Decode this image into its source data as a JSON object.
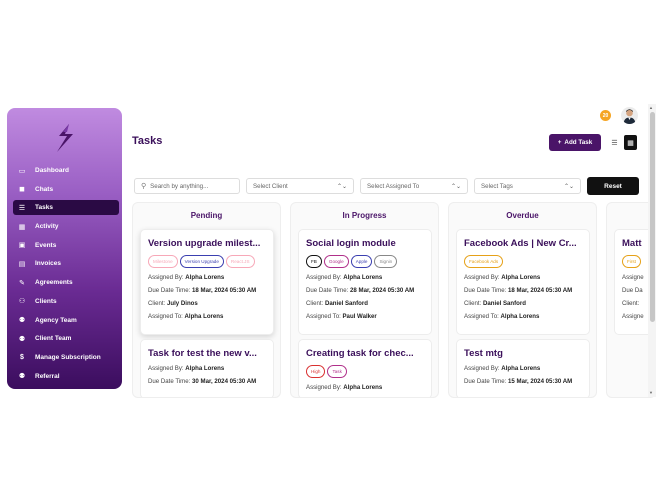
{
  "page": {
    "title": "Tasks"
  },
  "header": {
    "notification_count": "20",
    "add_task_label": "Add Task",
    "add_icon": "+"
  },
  "sidebar": {
    "items": [
      {
        "label": "Dashboard",
        "icon": "▭"
      },
      {
        "label": "Chats",
        "icon": "◼"
      },
      {
        "label": "Tasks",
        "icon": "☰"
      },
      {
        "label": "Activity",
        "icon": "▦"
      },
      {
        "label": "Events",
        "icon": "▣"
      },
      {
        "label": "Invoices",
        "icon": "▤"
      },
      {
        "label": "Agreements",
        "icon": "✎"
      },
      {
        "label": "Clients",
        "icon": "⚇"
      },
      {
        "label": "Agency Team",
        "icon": "⚉"
      },
      {
        "label": "Client Team",
        "icon": "⚉"
      },
      {
        "label": "Manage Subscription",
        "icon": "$"
      },
      {
        "label": "Referral",
        "icon": "⚉"
      }
    ],
    "active_index": 2
  },
  "filters": {
    "search_placeholder": "Search by anything...",
    "client": "Select Client",
    "assigned": "Select Assigned To",
    "tags": "Select Tags",
    "reset_label": "Reset"
  },
  "labels": {
    "assigned_by": "Assigned By:",
    "due": "Due Date Time:",
    "client": "Client:",
    "assigned_to": "Assigned To:"
  },
  "columns": [
    {
      "title": "Pending",
      "cards": [
        {
          "title": "Version upgrade milest...",
          "tags": [
            "Milestone",
            "Version Upgrade",
            "React.JS"
          ],
          "assigned_by": "Alpha Lorens",
          "due": "18 Mar, 2024 05:30 AM",
          "client": "July Dinos",
          "assigned_to": "Alpha Lorens"
        },
        {
          "title": "Task for test the new v...",
          "tags": [],
          "assigned_by": "Alpha Lorens",
          "due": "30 Mar, 2024 05:30 AM",
          "client": "",
          "assigned_to": ""
        }
      ]
    },
    {
      "title": "In Progress",
      "cards": [
        {
          "title": "Social login module",
          "tags": [
            "FB",
            "Google",
            "Apple",
            "Signin"
          ],
          "assigned_by": "Alpha Lorens",
          "due": "28 Mar, 2024 05:30 AM",
          "client": "Daniel Sanford",
          "assigned_to": "Paul Walker"
        },
        {
          "title": "Creating task for chec...",
          "tags": [
            "High",
            "Task"
          ],
          "assigned_by": "Alpha Lorens",
          "due": "",
          "client": "",
          "assigned_to": ""
        }
      ]
    },
    {
      "title": "Overdue",
      "cards": [
        {
          "title": "Facebook Ads | New Cr...",
          "tags": [
            "Facebook Ads"
          ],
          "assigned_by": "Alpha Lorens",
          "due": "18 Mar, 2024 05:30 AM",
          "client": "Daniel Sanford",
          "assigned_to": "Alpha Lorens"
        },
        {
          "title": "Test mtg",
          "tags": [],
          "assigned_by": "Alpha Lorens",
          "due": "15 Mar, 2024 05:30 AM",
          "client": "",
          "assigned_to": ""
        }
      ]
    },
    {
      "title": "",
      "cards": [
        {
          "title": "Matt",
          "tags": [
            "First"
          ],
          "assigned_by": "Assigne",
          "due": "Due Da",
          "client": "Client:",
          "assigned_to": "Assigne"
        }
      ]
    }
  ],
  "colors": {
    "brand": "#4a1468",
    "accent_title": "#3a0f5a",
    "notif": "#f5a524",
    "tag_colors": {
      "Milestone": "#f7a8b8",
      "Version Upgrade": "#3b3fb0",
      "React.JS": "#f7a8b8",
      "FB": "#111111",
      "Google": "#b0308a",
      "Apple": "#3b3fb0",
      "Signin": "#888888",
      "High": "#d93030",
      "Task": "#b0308a",
      "Facebook Ads": "#e6a118",
      "First": "#e6a118"
    }
  }
}
